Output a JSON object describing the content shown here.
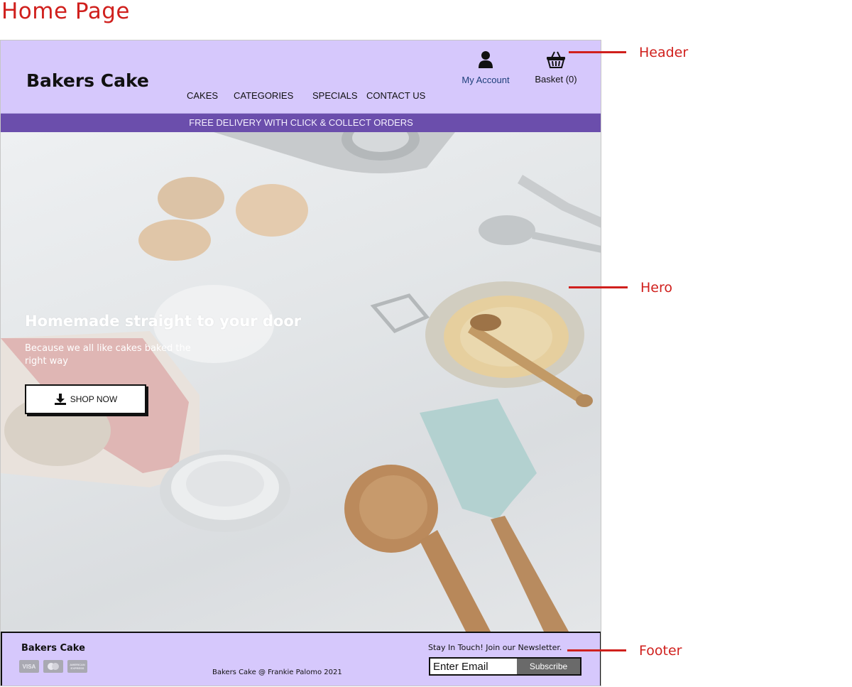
{
  "page_label": "Home Page",
  "header": {
    "logo": "Bakers Cake",
    "nav": [
      "CAKES",
      "CATEGORIES",
      "SPECIALS",
      "CONTACT US"
    ],
    "account_label": "My Account",
    "basket_label": "Basket (0)"
  },
  "banner": {
    "text": "FREE DELIVERY WITH CLICK & COLLECT ORDERS"
  },
  "hero": {
    "title": "Homemade straight to your door",
    "subtitle": "Because we all like cakes baked the right way",
    "button_label": "SHOP NOW"
  },
  "footer": {
    "brand": "Bakers Cake",
    "cards": [
      "VISA",
      "mastercard-icon",
      "AMERICAN EXPRESS"
    ],
    "copyright": "Bakers Cake @ Frankie Palomo 2021",
    "newsletter_label": "Stay In Touch! Join our Newsletter.",
    "email_placeholder": "Enter Email",
    "subscribe_label": "Subscribe"
  },
  "annotations": [
    "Header",
    "Hero",
    "Footer"
  ],
  "colors": {
    "header_bg": "#d6c8fc",
    "banner_bg": "#6b4eac",
    "annotation": "#d0201d",
    "subscribe_bg": "#6a6a6a"
  }
}
